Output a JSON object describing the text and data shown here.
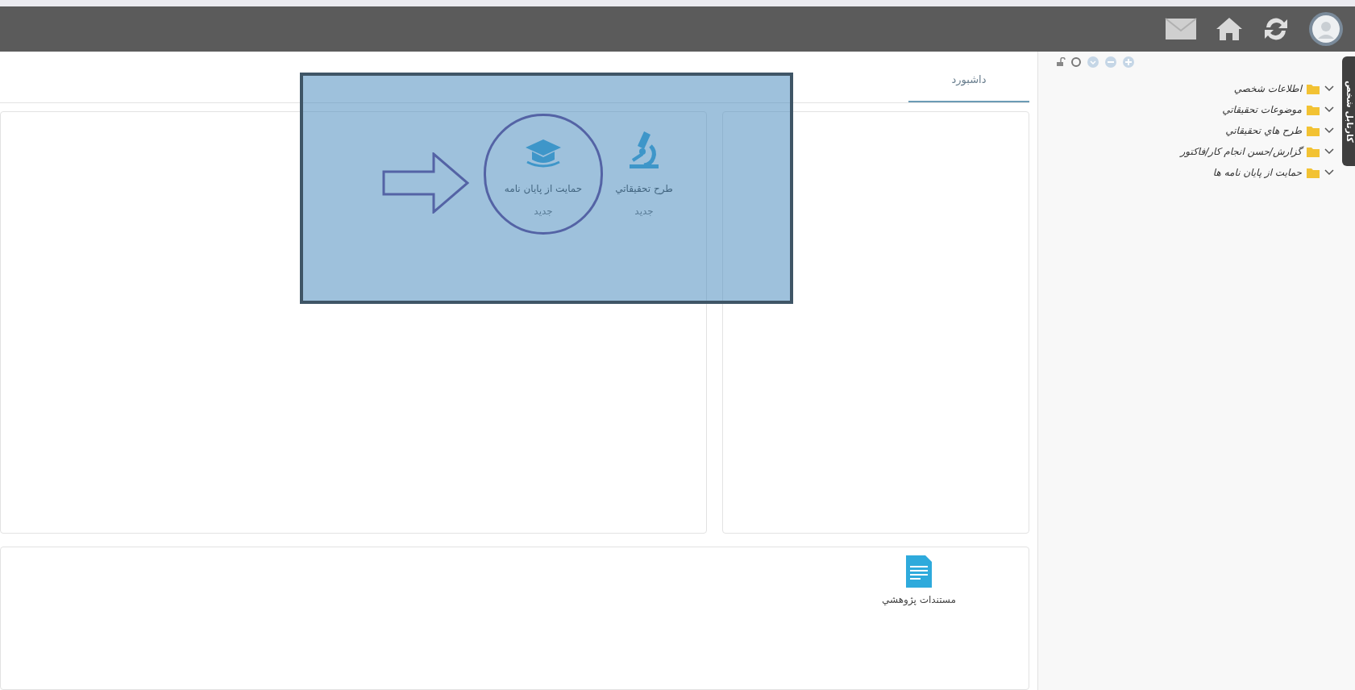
{
  "sidebar": {
    "vertical_tab": "کارتابل شخص",
    "tree": [
      {
        "label": "اطلاعات شخصي"
      },
      {
        "label": "موضوعات تحقيقاتي"
      },
      {
        "label": "طرح هاي تحقيقاتي"
      },
      {
        "label": "گزارش/حسن انجام کار/فاکتور"
      },
      {
        "label": "حمايت از پايان نامه ها"
      }
    ]
  },
  "tabs": [
    {
      "label": "داشبورد",
      "selected": true
    }
  ],
  "shortcuts": [
    {
      "kind": "microscope",
      "label": "طرح تحقيقاتي",
      "sublabel": "جديد",
      "highlighted": false
    },
    {
      "kind": "graduation-cap",
      "label": "حمايت از پايان نامه",
      "sublabel": "جديد",
      "highlighted": true
    }
  ],
  "documents": [
    {
      "kind": "document",
      "label": "مستندات پژوهشي"
    }
  ]
}
